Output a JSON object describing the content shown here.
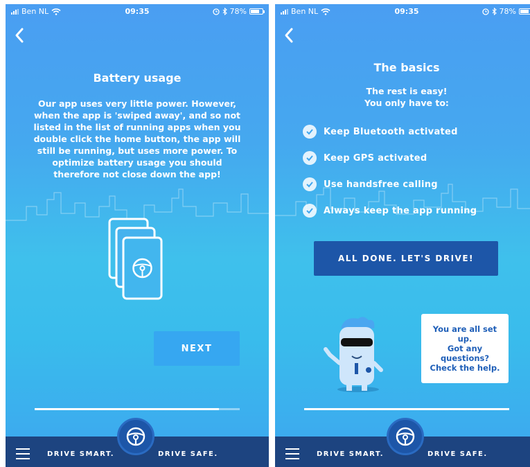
{
  "status": {
    "carrier": "Ben NL",
    "time": "09:35",
    "battery": "78%",
    "battery_level": 0.78
  },
  "left": {
    "title": "Battery usage",
    "paragraph": "Our app uses very little power. However, when the app is 'swiped away', and so not listed in the list of running apps when you double click the home button, the app will still be running, but uses more power. To optimize battery usage you should therefore not close down the app!",
    "next_label": "NEXT",
    "progress": 0.9
  },
  "right": {
    "title": "The basics",
    "subtitle_line1": "The rest is easy!",
    "subtitle_line2": "You only have to:",
    "checklist": [
      "Keep Bluetooth activated",
      "Keep GPS activated",
      "Use handsfree calling",
      "Always keep the app running"
    ],
    "done_label": "ALL DONE. LET'S DRIVE!",
    "help_text": "You are all set up.\nGot any\nquestions?\nCheck the help.",
    "progress": 1.0
  },
  "bottom": {
    "drive_smart": "DRIVE SMART.",
    "drive_safe": "DRIVE SAFE."
  },
  "icons": {
    "back": "chevron-left-icon",
    "wifi": "wifi-icon",
    "alarm": "alarm-icon",
    "bluetooth": "bluetooth-icon",
    "check": "check-circle-icon",
    "wheel": "steering-wheel-icon",
    "menu": "hamburger-menu-icon"
  },
  "colors": {
    "bg_top": "#4a9ef2",
    "bg_mid": "#3fc0ec",
    "primary_button": "#1d56a8",
    "secondary_button": "#36a7f1",
    "bottom_bar": "#1d4480"
  }
}
